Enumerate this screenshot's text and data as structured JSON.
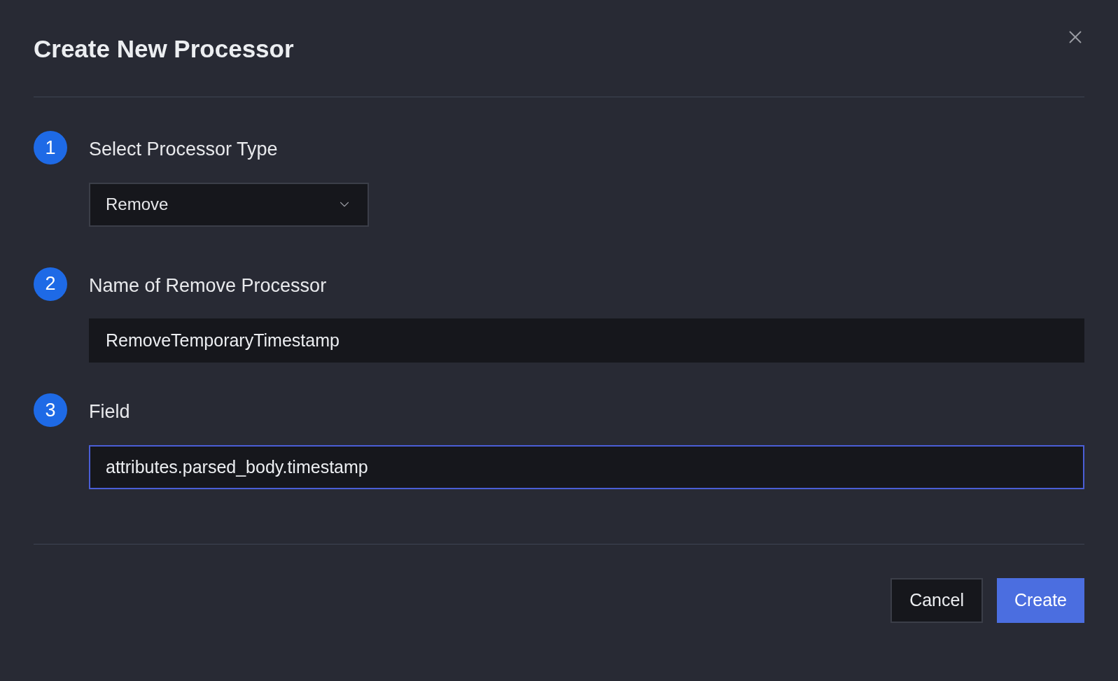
{
  "dialog": {
    "title": "Create New Processor"
  },
  "steps": [
    {
      "number": "1",
      "label": "Select Processor Type",
      "kind": "select",
      "value": "Remove",
      "focused": false
    },
    {
      "number": "2",
      "label": "Name of Remove Processor",
      "kind": "input",
      "value": "RemoveTemporaryTimestamp",
      "focused": false
    },
    {
      "number": "3",
      "label": "Field",
      "kind": "input",
      "value": "attributes.parsed_body.timestamp",
      "focused": true
    }
  ],
  "buttons": [
    {
      "label": "Cancel",
      "kind": "secondary"
    },
    {
      "label": "Create",
      "kind": "primary"
    }
  ]
}
